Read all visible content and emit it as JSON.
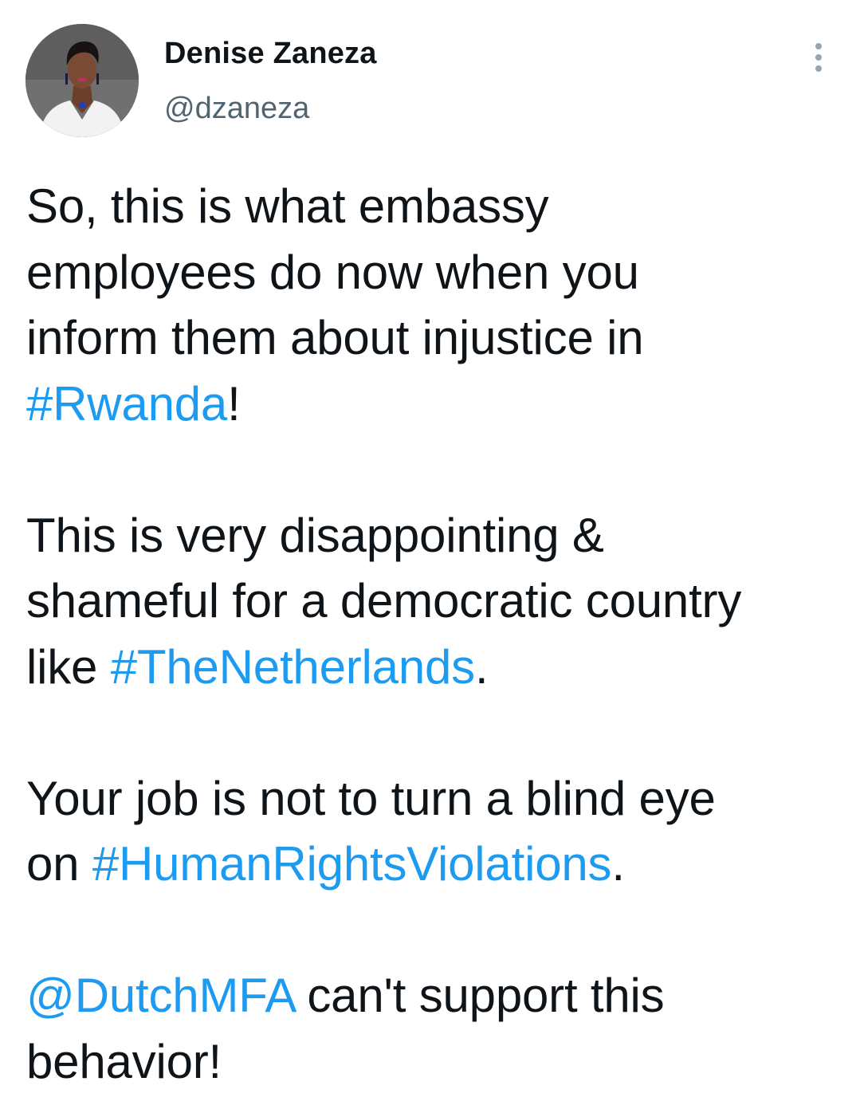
{
  "author": {
    "name": "Denise Zaneza",
    "handle": "@dzaneza",
    "avatar_icon": "profile-photo"
  },
  "menu": {
    "icon": "more-vertical-icon"
  },
  "tweet": {
    "p1": {
      "line1": "So, this is what embassy",
      "line2": "employees do now when you",
      "line3": "inform them about injustice in",
      "hashtag": "#Rwanda",
      "after": "!"
    },
    "p2": {
      "line1": "This is very disappointing &",
      "line2": "shameful for a democratic country",
      "before": "like ",
      "hashtag": "#TheNetherlands",
      "after": "."
    },
    "p3": {
      "line1": "Your job is not to turn a blind eye",
      "before": "on ",
      "hashtag": "#HumanRightsViolations",
      "after": "."
    },
    "p4": {
      "mention": "@DutchMFA",
      "after": " can't support this",
      "line2": "behavior!"
    }
  },
  "colors": {
    "link": "#1d9bf0",
    "text": "#0f1419",
    "secondary": "#536471"
  }
}
